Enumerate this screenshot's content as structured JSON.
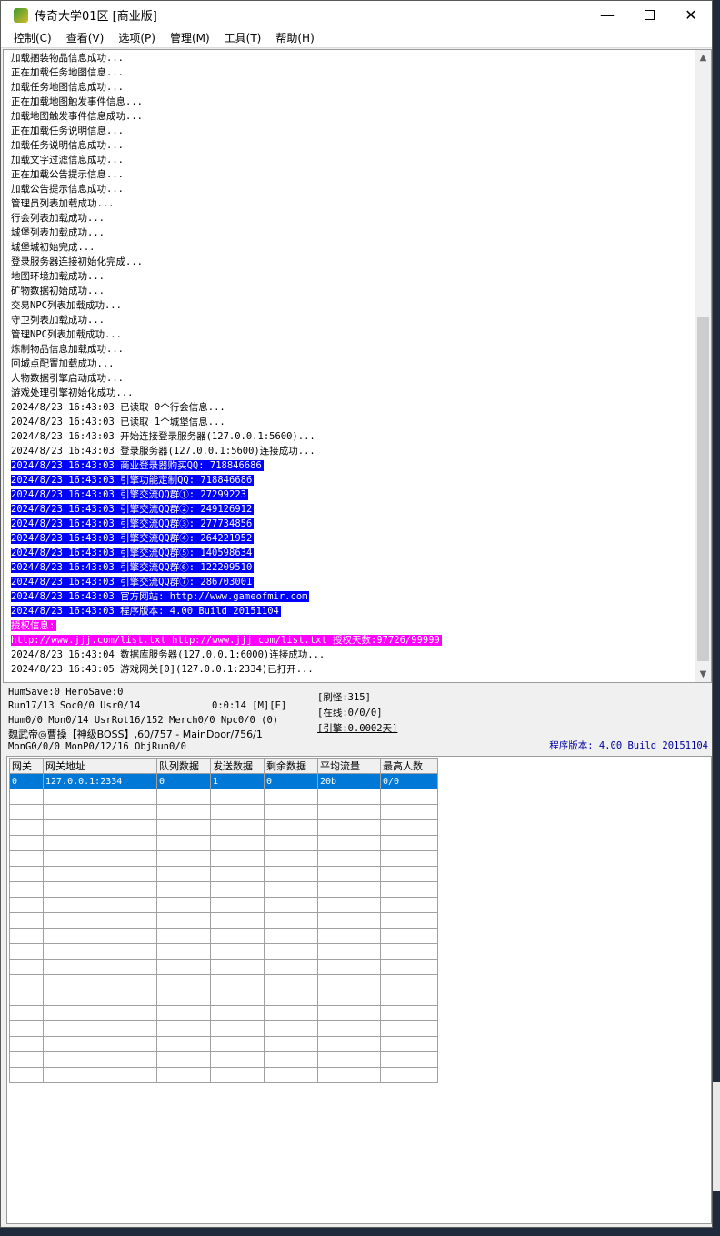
{
  "window": {
    "title": "传奇大学01区 [商业版]"
  },
  "menu": [
    "控制(C)",
    "查看(V)",
    "选项(P)",
    "管理(M)",
    "工具(T)",
    "帮助(H)"
  ],
  "log": [
    {
      "text": "加载捆装物品信息成功...",
      "style": ""
    },
    {
      "text": "正在加载任务地图信息...",
      "style": ""
    },
    {
      "text": "加载任务地图信息成功...",
      "style": ""
    },
    {
      "text": "正在加载地图触发事件信息...",
      "style": ""
    },
    {
      "text": "加载地图触发事件信息成功...",
      "style": ""
    },
    {
      "text": "正在加载任务说明信息...",
      "style": ""
    },
    {
      "text": "加载任务说明信息成功...",
      "style": ""
    },
    {
      "text": "加载文字过滤信息成功...",
      "style": ""
    },
    {
      "text": "正在加载公告提示信息...",
      "style": ""
    },
    {
      "text": "加载公告提示信息成功...",
      "style": ""
    },
    {
      "text": "管理员列表加载成功...",
      "style": ""
    },
    {
      "text": "行会列表加载成功...",
      "style": ""
    },
    {
      "text": "城堡列表加载成功...",
      "style": ""
    },
    {
      "text": "城堡城初始完成...",
      "style": ""
    },
    {
      "text": "登录服务器连接初始化完成...",
      "style": ""
    },
    {
      "text": "地图环境加载成功...",
      "style": ""
    },
    {
      "text": "矿物数据初始成功...",
      "style": ""
    },
    {
      "text": "交易NPC列表加载成功...",
      "style": ""
    },
    {
      "text": "守卫列表加载成功...",
      "style": ""
    },
    {
      "text": "管理NPC列表加载成功...",
      "style": ""
    },
    {
      "text": "炼制物品信息加载成功...",
      "style": ""
    },
    {
      "text": "回城点配置加载成功...",
      "style": ""
    },
    {
      "text": "人物数据引擎启动成功...",
      "style": ""
    },
    {
      "text": "游戏处理引擎初始化成功...",
      "style": ""
    },
    {
      "text": "2024/8/23 16:43:03 已读取 0个行会信息...",
      "style": ""
    },
    {
      "text": "2024/8/23 16:43:03 已读取 1个城堡信息...",
      "style": ""
    },
    {
      "text": "2024/8/23 16:43:03 开始连接登录服务器(127.0.0.1:5600)...",
      "style": ""
    },
    {
      "text": "2024/8/23 16:43:03 登录服务器(127.0.0.1:5600)连接成功...",
      "style": ""
    },
    {
      "text": "2024/8/23 16:43:03 商业登录器购买QQ: 718846686",
      "style": "blue"
    },
    {
      "text": "2024/8/23 16:43:03 引擎功能定制QQ: 718846686",
      "style": "blue"
    },
    {
      "text": "2024/8/23 16:43:03 引擎交流QQ群①: 27299223",
      "style": "blue"
    },
    {
      "text": "2024/8/23 16:43:03 引擎交流QQ群②: 249126912",
      "style": "blue"
    },
    {
      "text": "2024/8/23 16:43:03 引擎交流QQ群③: 277734856",
      "style": "blue"
    },
    {
      "text": "2024/8/23 16:43:03 引擎交流QQ群④: 264221952",
      "style": "blue"
    },
    {
      "text": "2024/8/23 16:43:03 引擎交流QQ群⑤: 140598634",
      "style": "blue"
    },
    {
      "text": "2024/8/23 16:43:03 引擎交流QQ群⑥: 122209510",
      "style": "blue"
    },
    {
      "text": "2024/8/23 16:43:03 引擎交流QQ群⑦: 286703001",
      "style": "blue"
    },
    {
      "text": "2024/8/23 16:43:03 官方网站: http://www.gameofmir.com",
      "style": "blue"
    },
    {
      "text": "2024/8/23 16:43:03 程序版本: 4.00 Build 20151104",
      "style": "blue"
    },
    {
      "text": "授权信息:",
      "style": "magenta"
    },
    {
      "text": "http://www.jjj.com/list.txt http://www.jjj.com/list.txt 授权天数:97726/99999",
      "style": "magenta"
    },
    {
      "text": "2024/8/23 16:43:04 数据库服务器(127.0.0.1:6000)连接成功...",
      "style": ""
    },
    {
      "text": "2024/8/23 16:43:05 游戏网关[0](127.0.0.1:2334)已打开...",
      "style": ""
    }
  ],
  "status": {
    "line1": "HumSave:0 HeroSave:0",
    "line2": "Run17/13 Soc0/0 Usr0/14",
    "timer": "0:0:14 [M][F]",
    "line3": "Hum0/0 Mon0/14 UsrRot16/152 Merch0/0 Npc0/0 (0)",
    "line4": "魏武帝◎曹操【神级BOSS】,60/757 - MainDoor/756/1",
    "line5": "MonG0/0/0 MonP0/12/16 ObjRun0/0",
    "refresh": "[刷怪:315]",
    "online": "[在线:0/0/0]",
    "engine": "[引擎:0.0002天]",
    "version": "程序版本: 4.00 Build 20151104"
  },
  "grid": {
    "columns": [
      "网关",
      "网关地址",
      "队列数据",
      "发送数据",
      "剩余数据",
      "平均流量",
      "最高人数"
    ],
    "rows": [
      [
        "0",
        "127.0.0.1:2334",
        "0",
        "1",
        "0",
        "20b",
        "0/0"
      ]
    ]
  },
  "colors": {
    "highlight_blue": "#0000ff",
    "highlight_magenta": "#ff00ff",
    "selection": "#0078d7"
  }
}
